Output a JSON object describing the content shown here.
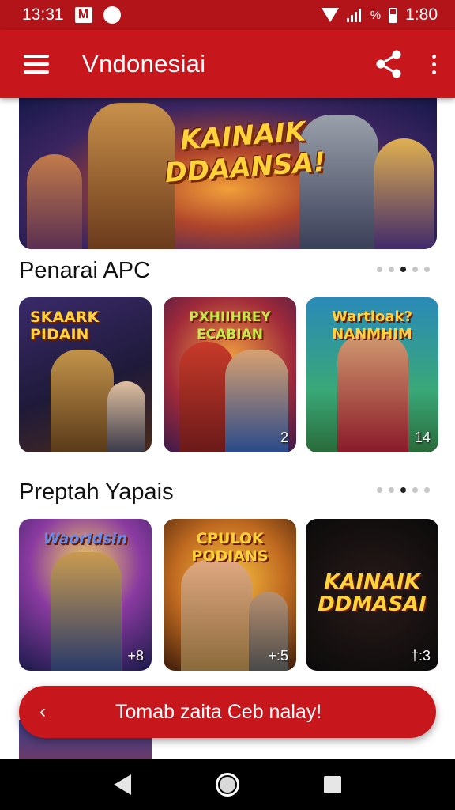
{
  "status_bar": {
    "time": "13:31",
    "notif_letter": "M",
    "signal_text": "%",
    "battery_text": "1:80"
  },
  "app_bar": {
    "title": "Vndonesiai",
    "menu_icon": "hamburger-icon",
    "share_icon": "share-icon",
    "more_icon": "more-vert-icon"
  },
  "hero": {
    "title": "KAINAIK DDAANSA!"
  },
  "sections": [
    {
      "title": "Penarai  APC",
      "cards": [
        {
          "title": "SKAARK PIDAIN",
          "badge": ""
        },
        {
          "title": "PXHIIHREY ECABIAN",
          "badge": "2"
        },
        {
          "title": "Wartloak? NANMHIM",
          "badge": "14"
        }
      ]
    },
    {
      "title": "Preptah Yapais",
      "cards": [
        {
          "title": "Waorldsin",
          "badge": "+8"
        },
        {
          "title": "CPULOK PODIANS",
          "badge": "+:5"
        },
        {
          "title": "KAINAIK DDMASAI",
          "badge": "†:3"
        }
      ]
    }
  ],
  "pill": {
    "chevron": "‹",
    "label": "Tomab zaita Ceb nalay!"
  },
  "colors": {
    "brand_red": "#c8161d",
    "status_red": "#b3141a"
  }
}
